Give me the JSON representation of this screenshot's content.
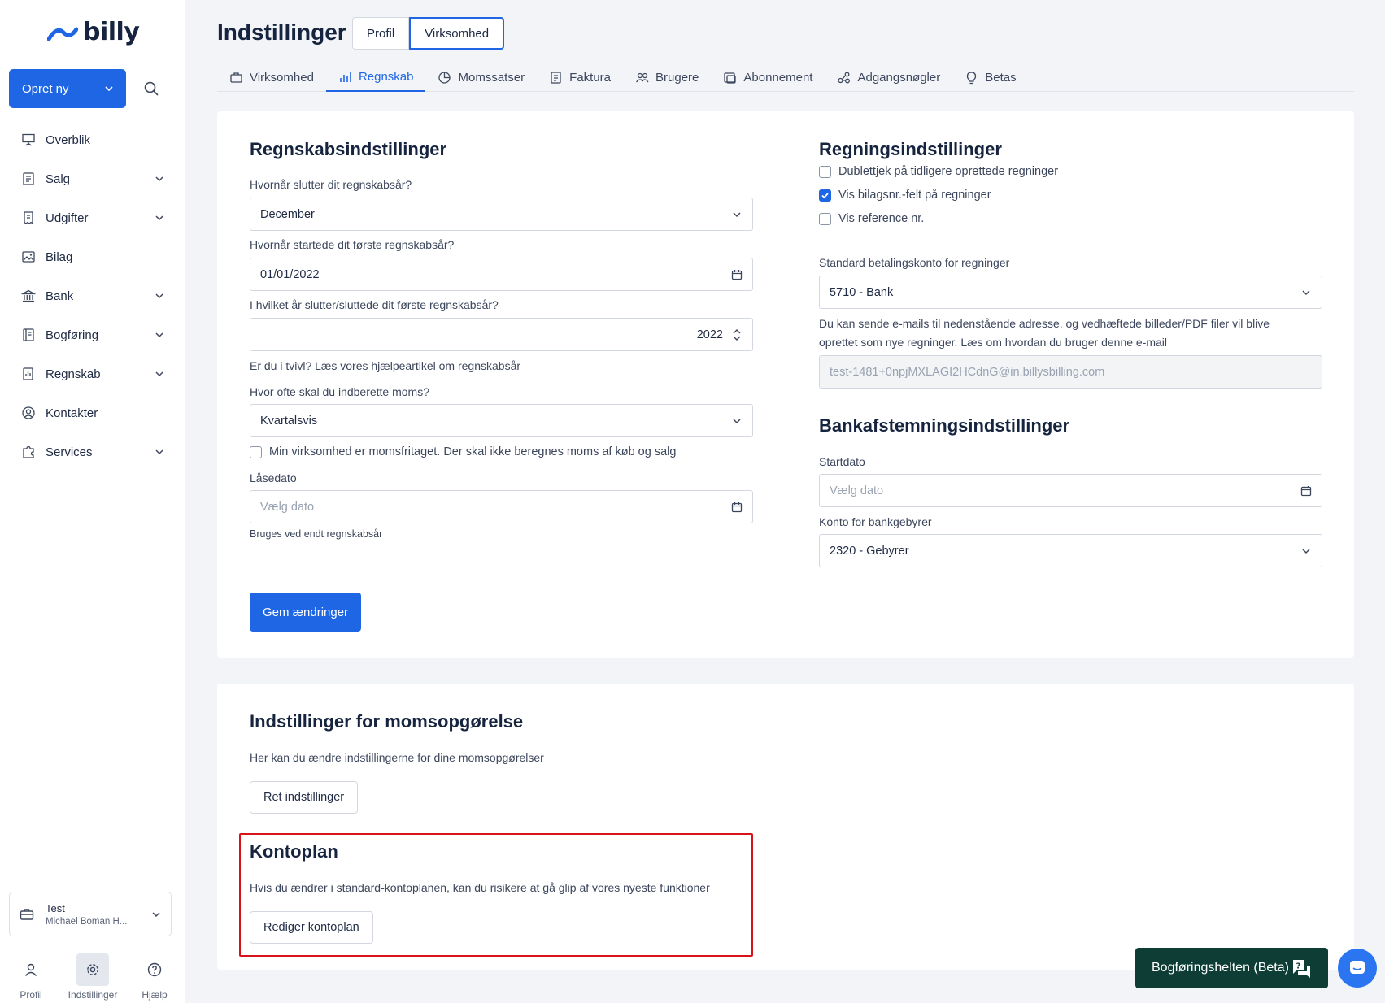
{
  "app": {
    "logo_text": "billy"
  },
  "sidebar": {
    "create_label": "Opret ny",
    "items": [
      {
        "label": "Overblik",
        "icon": "presentation-icon",
        "has_chevron": false
      },
      {
        "label": "Salg",
        "icon": "invoice-icon",
        "has_chevron": true
      },
      {
        "label": "Udgifter",
        "icon": "receipt-icon",
        "has_chevron": true
      },
      {
        "label": "Bilag",
        "icon": "image-icon",
        "has_chevron": false
      },
      {
        "label": "Bank",
        "icon": "bank-icon",
        "has_chevron": true
      },
      {
        "label": "Bogføring",
        "icon": "ledger-icon",
        "has_chevron": true
      },
      {
        "label": "Regnskab",
        "icon": "report-icon",
        "has_chevron": true
      },
      {
        "label": "Kontakter",
        "icon": "contact-icon",
        "has_chevron": false
      },
      {
        "label": "Services",
        "icon": "puzzle-icon",
        "has_chevron": true
      }
    ],
    "org": {
      "name": "Test",
      "user": "Michael Boman H..."
    },
    "bottom": {
      "profile": "Profil",
      "settings": "Indstillinger",
      "help": "Hjælp"
    }
  },
  "header": {
    "title": "Indstillinger",
    "segments": {
      "profile": "Profil",
      "company": "Virksomhed"
    },
    "tabs": [
      "Virksomhed",
      "Regnskab",
      "Momssatser",
      "Faktura",
      "Brugere",
      "Abonnement",
      "Adgangsnøgler",
      "Betas"
    ],
    "active_tab": "Regnskab"
  },
  "accounting": {
    "title": "Regnskabsindstillinger",
    "fiscal_end_label": "Hvornår slutter dit regnskabsår?",
    "fiscal_end_value": "December",
    "first_start_label": "Hvornår startede dit første regnskabsår?",
    "first_start_value": "01/01/2022",
    "first_end_label": "I hvilket år slutter/sluttede dit første regnskabsår?",
    "first_end_value": "2022",
    "help_text": "Er du i tvivl? Læs vores hjælpeartikel om regnskabsår",
    "vat_freq_label": "Hvor ofte skal du indberette moms?",
    "vat_freq_value": "Kvartalsvis",
    "vat_exempt_label": "Min virksomhed er momsfritaget. Der skal ikke beregnes moms af køb og salg",
    "vat_exempt_checked": false,
    "lock_label": "Låsedato",
    "lock_placeholder": "Vælg dato",
    "lock_hint": "Bruges ved endt regnskabsår",
    "save_label": "Gem ændringer"
  },
  "bills": {
    "title": "Regningsindstillinger",
    "options": [
      {
        "label": "Dublettjek på tidligere oprettede regninger",
        "checked": false
      },
      {
        "label": "Vis bilagsnr.-felt på regninger",
        "checked": true
      },
      {
        "label": "Vis reference nr.",
        "checked": false
      }
    ],
    "pay_account_label": "Standard betalingskonto for regninger",
    "pay_account_value": "5710 -  Bank",
    "email_info_1": "Du kan sende e-mails til nedenstående adresse, og vedhæftede billeder/PDF filer vil blive",
    "email_info_2": "oprettet som nye regninger. Læs om hvordan du bruger denne e-mail",
    "email_value": "test-1481+0npjMXLAGI2HCdnG@in.billysbilling.com"
  },
  "bank": {
    "title": "Bankafstemningsindstillinger",
    "start_label": "Startdato",
    "start_placeholder": "Vælg dato",
    "fee_label": "Konto for bankgebyrer",
    "fee_value": "2320 -  Gebyrer"
  },
  "vat_report": {
    "title": "Indstillinger for momsopgørelse",
    "desc": "Her kan du ændre indstillingerne for dine momsopgørelser",
    "button": "Ret indstillinger"
  },
  "chart_of_accounts": {
    "title": "Kontoplan",
    "desc": "Hvis du ændrer i standard-kontoplanen, kan du risikere at gå glip af vores nyeste funktioner",
    "button": "Rediger kontoplan"
  },
  "assistant": {
    "label": "Bogføringshelten (Beta)"
  },
  "colors": {
    "primary": "#1f66e5",
    "assistant_bg": "#0e3d36",
    "highlight": "#d8141a"
  }
}
